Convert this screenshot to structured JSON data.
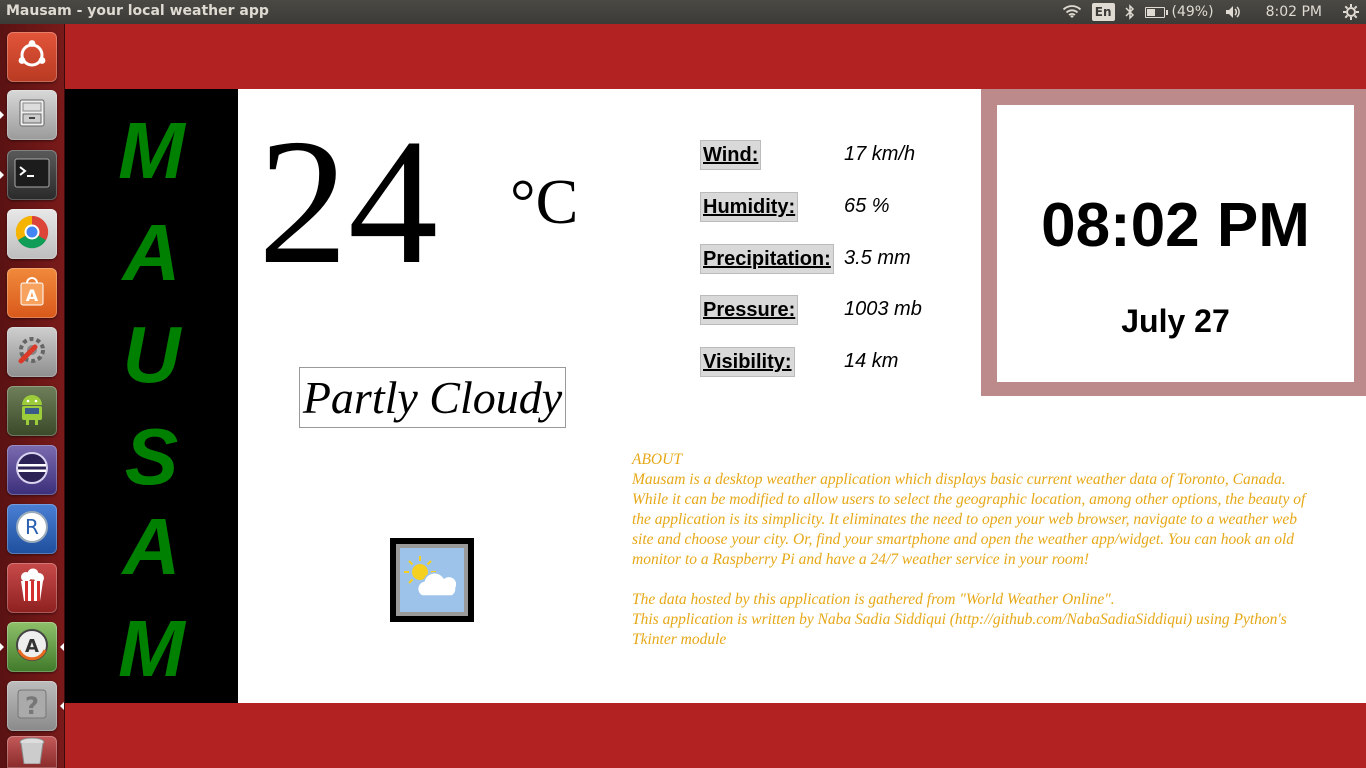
{
  "window": {
    "title": "Mausam - your local weather app"
  },
  "tray": {
    "language": "En",
    "battery_percent_text": "(49%)",
    "battery_level": 0.49,
    "time": "8:02 PM"
  },
  "launcher": {
    "items": [
      {
        "name": "ubuntu-dash",
        "running": false
      },
      {
        "name": "files",
        "running": true
      },
      {
        "name": "terminal",
        "running": true
      },
      {
        "name": "chrome",
        "running": false
      },
      {
        "name": "software-center",
        "running": false
      },
      {
        "name": "system-settings",
        "running": false
      },
      {
        "name": "android-studio",
        "running": false
      },
      {
        "name": "eclipse",
        "running": false
      },
      {
        "name": "r-studio",
        "running": false
      },
      {
        "name": "popcorn-time",
        "running": false
      },
      {
        "name": "software-updater",
        "running": true
      },
      {
        "name": "help",
        "running": false
      },
      {
        "name": "trash",
        "running": false
      }
    ],
    "ubuntu_letter": "",
    "r_letter": "R",
    "help_glyph": "?",
    "update_letter": "A",
    "store_letter": "A"
  },
  "app": {
    "brand_letters": [
      "M",
      "A",
      "U",
      "S",
      "A",
      "M"
    ],
    "temperature": "24",
    "unit": "°C",
    "condition": "Partly Cloudy",
    "condition_icon": "partly-cloudy-icon",
    "stats": [
      {
        "label": "Wind:",
        "value": "17 km/h"
      },
      {
        "label": "Humidity:",
        "value": "65 %"
      },
      {
        "label": "Precipitation:",
        "value": "3.5 mm"
      },
      {
        "label": "Pressure:",
        "value": "1003 mb"
      },
      {
        "label": "Visibility:",
        "value": "14 km"
      }
    ],
    "clock": {
      "time": "08:02 PM",
      "date": "July 27"
    },
    "about": {
      "heading": "ABOUT",
      "paragraph": "Mausam is a desktop weather application which displays basic current weather data of Toronto, Canada. While it can be modified to allow users to select the geographic location, among other options, the beauty of the application is its simplicity. It eliminates the need to open your web browser, navigate to a weather web site and choose your city. Or, find your smartphone and open the weather app/widget. You can hook an old monitor to a Raspberry Pi and have a 24/7 weather service in your room!",
      "source": "The data hosted by this application is gathered from \"World Weather Online\".",
      "credits": "This application is written by Naba Sadia Siddiqui (http://github.com/NabaSadiaSiddiqui) using Python's Tkinter module"
    }
  },
  "colors": {
    "background": "#b22222",
    "brand_green": "#008000",
    "about_text": "#e6a817",
    "clock_frame": "#bc8a8a"
  }
}
